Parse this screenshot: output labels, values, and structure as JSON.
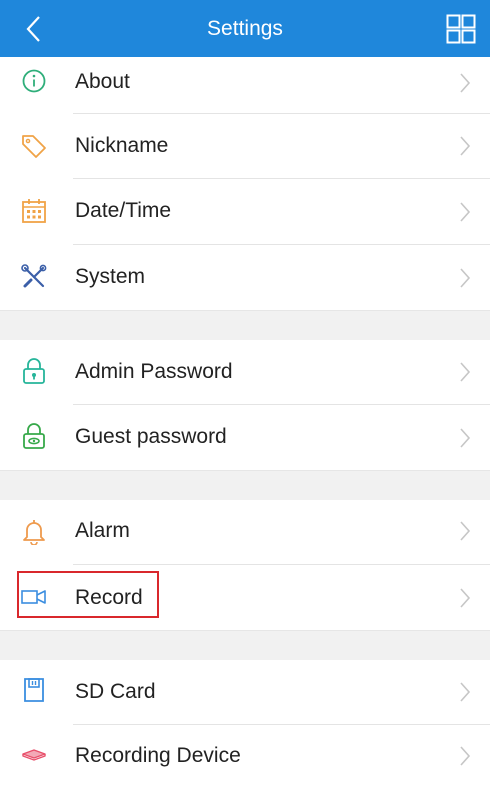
{
  "colors": {
    "header_bg": "#1f87db",
    "highlight_border": "#d9282c"
  },
  "header": {
    "title": "Settings",
    "back_icon": "chevron-left-icon",
    "menu_icon": "grid-icon"
  },
  "sections": [
    {
      "items": [
        {
          "label": "About",
          "icon": "info-icon"
        },
        {
          "label": "Nickname",
          "icon": "tag-icon"
        },
        {
          "label": "Date/Time",
          "icon": "calendar-icon"
        },
        {
          "label": "System",
          "icon": "tools-icon"
        }
      ]
    },
    {
      "items": [
        {
          "label": "Admin Password",
          "icon": "lock-icon"
        },
        {
          "label": "Guest password",
          "icon": "guest-lock-icon"
        }
      ]
    },
    {
      "items": [
        {
          "label": "Alarm",
          "icon": "bell-icon"
        },
        {
          "label": "Record",
          "icon": "video-camera-icon",
          "highlighted": true
        }
      ]
    },
    {
      "items": [
        {
          "label": "SD Card",
          "icon": "sd-card-icon"
        },
        {
          "label": "Recording Device",
          "icon": "recording-device-icon"
        }
      ]
    }
  ]
}
